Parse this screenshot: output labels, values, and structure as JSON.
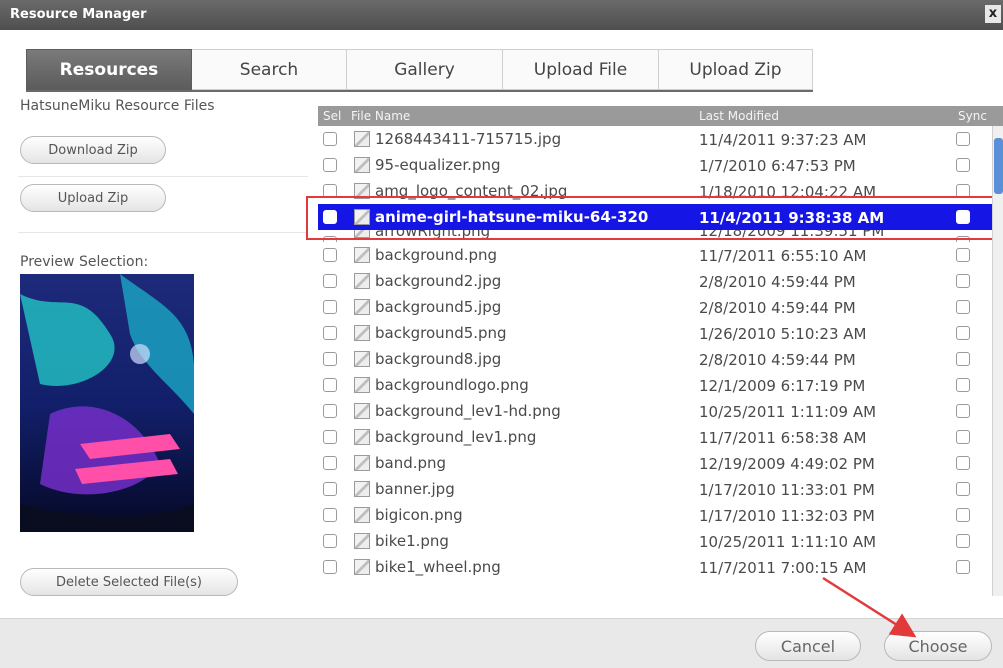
{
  "window": {
    "title": "Resource Manager",
    "close_glyph": "x"
  },
  "tabs": [
    {
      "label": "Resources",
      "active": true
    },
    {
      "label": "Search"
    },
    {
      "label": "Gallery"
    },
    {
      "label": "Upload File"
    },
    {
      "label": "Upload Zip"
    }
  ],
  "left": {
    "title": "HatsuneMiku Resource Files",
    "download_zip": "Download Zip",
    "upload_zip": "Upload Zip",
    "preview_label": "Preview Selection:",
    "delete_label": "Delete Selected File(s)"
  },
  "list": {
    "columns": {
      "sel": "Sel",
      "file_name": "File Name",
      "last_modified": "Last Modified",
      "sync": "Sync"
    },
    "rows": [
      {
        "name": "1268443411-715715.jpg",
        "modified": "11/4/2011 9:37:23 AM"
      },
      {
        "name": "95-equalizer.png",
        "modified": "1/7/2010 6:47:53 PM"
      },
      {
        "name": "amg_logo_content_02.jpg",
        "modified": "1/18/2010 12:04:22 AM"
      },
      {
        "name": "anime-girl-hatsune-miku-64-320",
        "modified": "11/4/2011 9:38:38 AM",
        "selected": true
      },
      {
        "name": "arrowRight.png",
        "modified": "12/18/2009 11:39:51 PM"
      },
      {
        "name": "background.png",
        "modified": "11/7/2011 6:55:10 AM"
      },
      {
        "name": "background2.jpg",
        "modified": "2/8/2010 4:59:44 PM"
      },
      {
        "name": "background5.jpg",
        "modified": "2/8/2010 4:59:44 PM"
      },
      {
        "name": "background5.png",
        "modified": "1/26/2010 5:10:23 AM"
      },
      {
        "name": "background8.jpg",
        "modified": "2/8/2010 4:59:44 PM"
      },
      {
        "name": "backgroundlogo.png",
        "modified": "12/1/2009 6:17:19 PM"
      },
      {
        "name": "background_lev1-hd.png",
        "modified": "10/25/2011 1:11:09 AM"
      },
      {
        "name": "background_lev1.png",
        "modified": "11/7/2011 6:58:38 AM"
      },
      {
        "name": "band.png",
        "modified": "12/19/2009 4:49:02 PM"
      },
      {
        "name": "banner.jpg",
        "modified": "1/17/2010 11:33:01 PM"
      },
      {
        "name": "bigicon.png",
        "modified": "1/17/2010 11:32:03 PM"
      },
      {
        "name": "bike1.png",
        "modified": "10/25/2011 1:11:10 AM"
      },
      {
        "name": "bike1_wheel.png",
        "modified": "11/7/2011 7:00:15 AM"
      }
    ]
  },
  "footer": {
    "cancel": "Cancel",
    "choose": "Choose"
  },
  "colors": {
    "selection": "#1515e6",
    "highlight": "#e23a3a",
    "titlebar": "#5a5a5a"
  }
}
